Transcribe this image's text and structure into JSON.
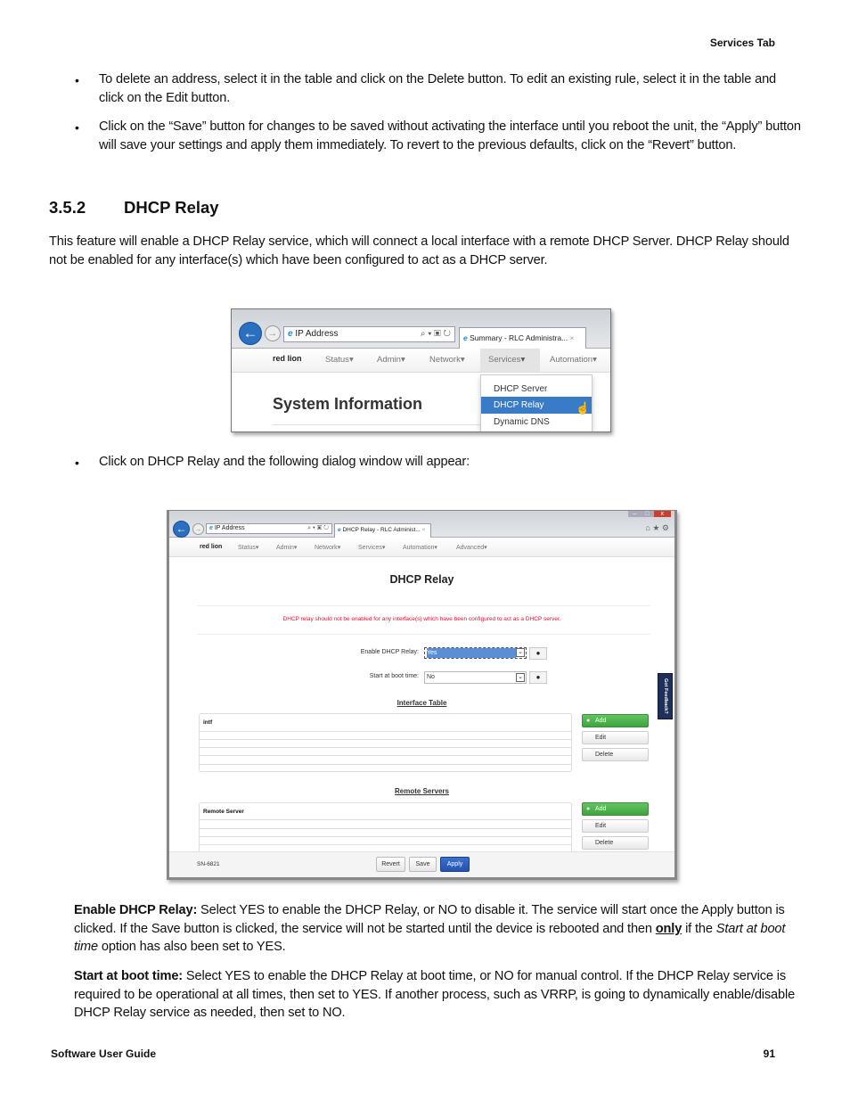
{
  "header": {
    "section": "Services Tab"
  },
  "bullets_top": [
    "To delete an address, select it in the table and click on the Delete button. To edit an existing rule, select it in the table and click on the Edit button.",
    "Click on the “Save” button for changes to be saved without activating the interface until you reboot the unit, the “Apply” button will save your settings and apply them immediately. To revert to the previous defaults, click on the “Revert” button."
  ],
  "section": {
    "number": "3.5.2",
    "title": "DHCP Relay",
    "intro": "This feature will enable a DHCP Relay service, which will connect a local interface with a remote DHCP Server. DHCP Relay should not be enabled for any interface(s) which have been configured to act as a DHCP server."
  },
  "shot1": {
    "address": "IP Address",
    "tab": "Summary - RLC Administra...",
    "logo": "red lion",
    "nav": [
      "Status",
      "Admin",
      "Network",
      "Services",
      "Automation"
    ],
    "dropdown": [
      "DHCP Server",
      "DHCP Relay",
      "Dynamic DNS"
    ],
    "heading": "System Information"
  },
  "bullet_mid": "Click on DHCP Relay and the following dialog window will appear:",
  "shot2": {
    "address": "IP Address",
    "tab": "DHCP Relay - RLC Administ...",
    "logo": "red lion",
    "nav": [
      "Status",
      "Admin",
      "Network",
      "Services",
      "Automation",
      "Advanced"
    ],
    "title": "DHCP Relay",
    "warning": "DHCP relay should not be enabled for any interface(s) which have been configured to act as a DHCP server.",
    "warning_color": "#e8112d",
    "enable_label": "Enable DHCP Relay:",
    "enable_value": "Yes",
    "boot_label": "Start at boot time:",
    "boot_value": "No",
    "interface_table": {
      "title": "Interface Table",
      "column": "intf"
    },
    "remote_table": {
      "title": "Remote Servers",
      "column": "Remote Server"
    },
    "buttons": {
      "add": "Add",
      "edit": "Edit",
      "delete": "Delete"
    },
    "feedback": "Got Feedback?",
    "serial": "SN-6821",
    "footer_buttons": {
      "revert": "Revert",
      "save": "Save",
      "apply": "Apply"
    }
  },
  "desc": [
    {
      "term": "Enable DHCP Relay:",
      "pre": " Select YES to enable the DHCP Relay, or NO to disable it. The service will start once the Apply button is clicked. If the Save button is clicked, the service will not be started until the device is rebooted and then ",
      "emph": "only",
      "mid": " if the ",
      "ital": "Start at boot time",
      "post": " option has also been set to YES."
    },
    {
      "term": "Start at boot time:",
      "text": " Select YES to enable the DHCP Relay at boot time, or NO for manual control. If the DHCP Relay service is required to be operational at all times, then set to YES. If another process, such as VRRP, is going to dynamically enable/disable DHCP Relay service as needed, then set to NO."
    }
  ],
  "footer": {
    "left": "Software User Guide",
    "page": "91"
  }
}
